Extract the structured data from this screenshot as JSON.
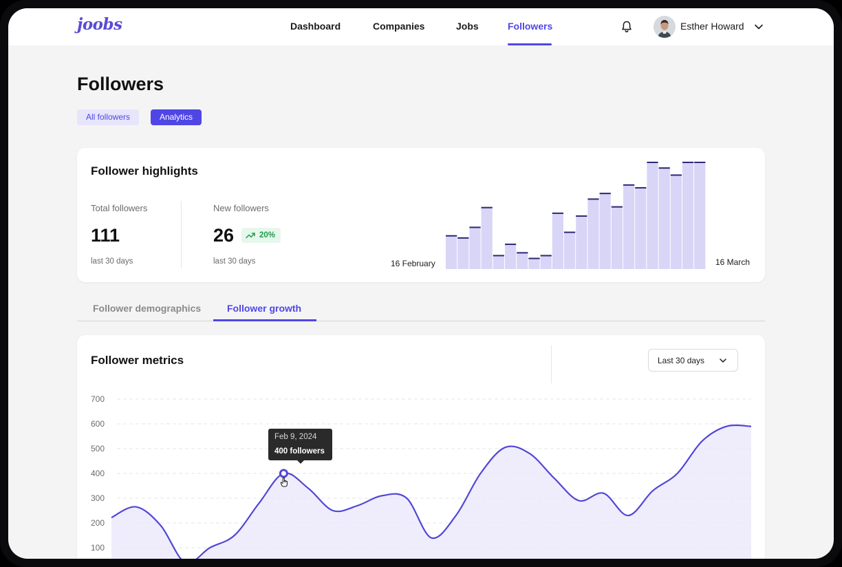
{
  "app": {
    "logo": "joobs"
  },
  "nav": {
    "items": [
      {
        "label": "Dashboard"
      },
      {
        "label": "Companies"
      },
      {
        "label": "Jobs"
      },
      {
        "label": "Followers"
      }
    ],
    "active": "Followers"
  },
  "user": {
    "name": "Esther Howard"
  },
  "page": {
    "title": "Followers",
    "view_tabs": [
      "All followers",
      "Analytics"
    ],
    "active_view": "Analytics"
  },
  "highlights": {
    "title": "Follower highlights",
    "total": {
      "label": "Total followers",
      "value": "111",
      "sub": "last 30 days"
    },
    "new": {
      "label": "New followers",
      "value": "26",
      "sub": "last 30 days",
      "change": "20%"
    },
    "bars": {
      "start_label": "16 February",
      "end_label": "16 March",
      "values": [
        48,
        45,
        60,
        88,
        20,
        36,
        24,
        16,
        20,
        80,
        53,
        76,
        100,
        108,
        89,
        120,
        116,
        152,
        144,
        134,
        152,
        152
      ],
      "color": "#d8d5f7",
      "cap_color": "#2d2873"
    }
  },
  "section_tabs": [
    "Follower demographics",
    "Follower growth"
  ],
  "active_section": "Follower growth",
  "metrics": {
    "title": "Follower metrics",
    "range": "Last 30 days",
    "tooltip": {
      "date": "Feb 9, 2024",
      "value": "400 followers"
    }
  },
  "chart_data": {
    "type": "area",
    "title": "Follower metrics",
    "ylim": [
      0,
      700
    ],
    "yticks": [
      100,
      200,
      300,
      400,
      500,
      600,
      700
    ],
    "grid": true,
    "series": [
      {
        "values": [
          222,
          265,
          190,
          40,
          100,
          150,
          280,
          400,
          340,
          250,
          270,
          310,
          300,
          140,
          230,
          400,
          505,
          480,
          380,
          290,
          320,
          230,
          330,
          400,
          530,
          590,
          590
        ]
      }
    ],
    "line_color": "#5046d6",
    "fill_color": "#ebe9fb"
  }
}
